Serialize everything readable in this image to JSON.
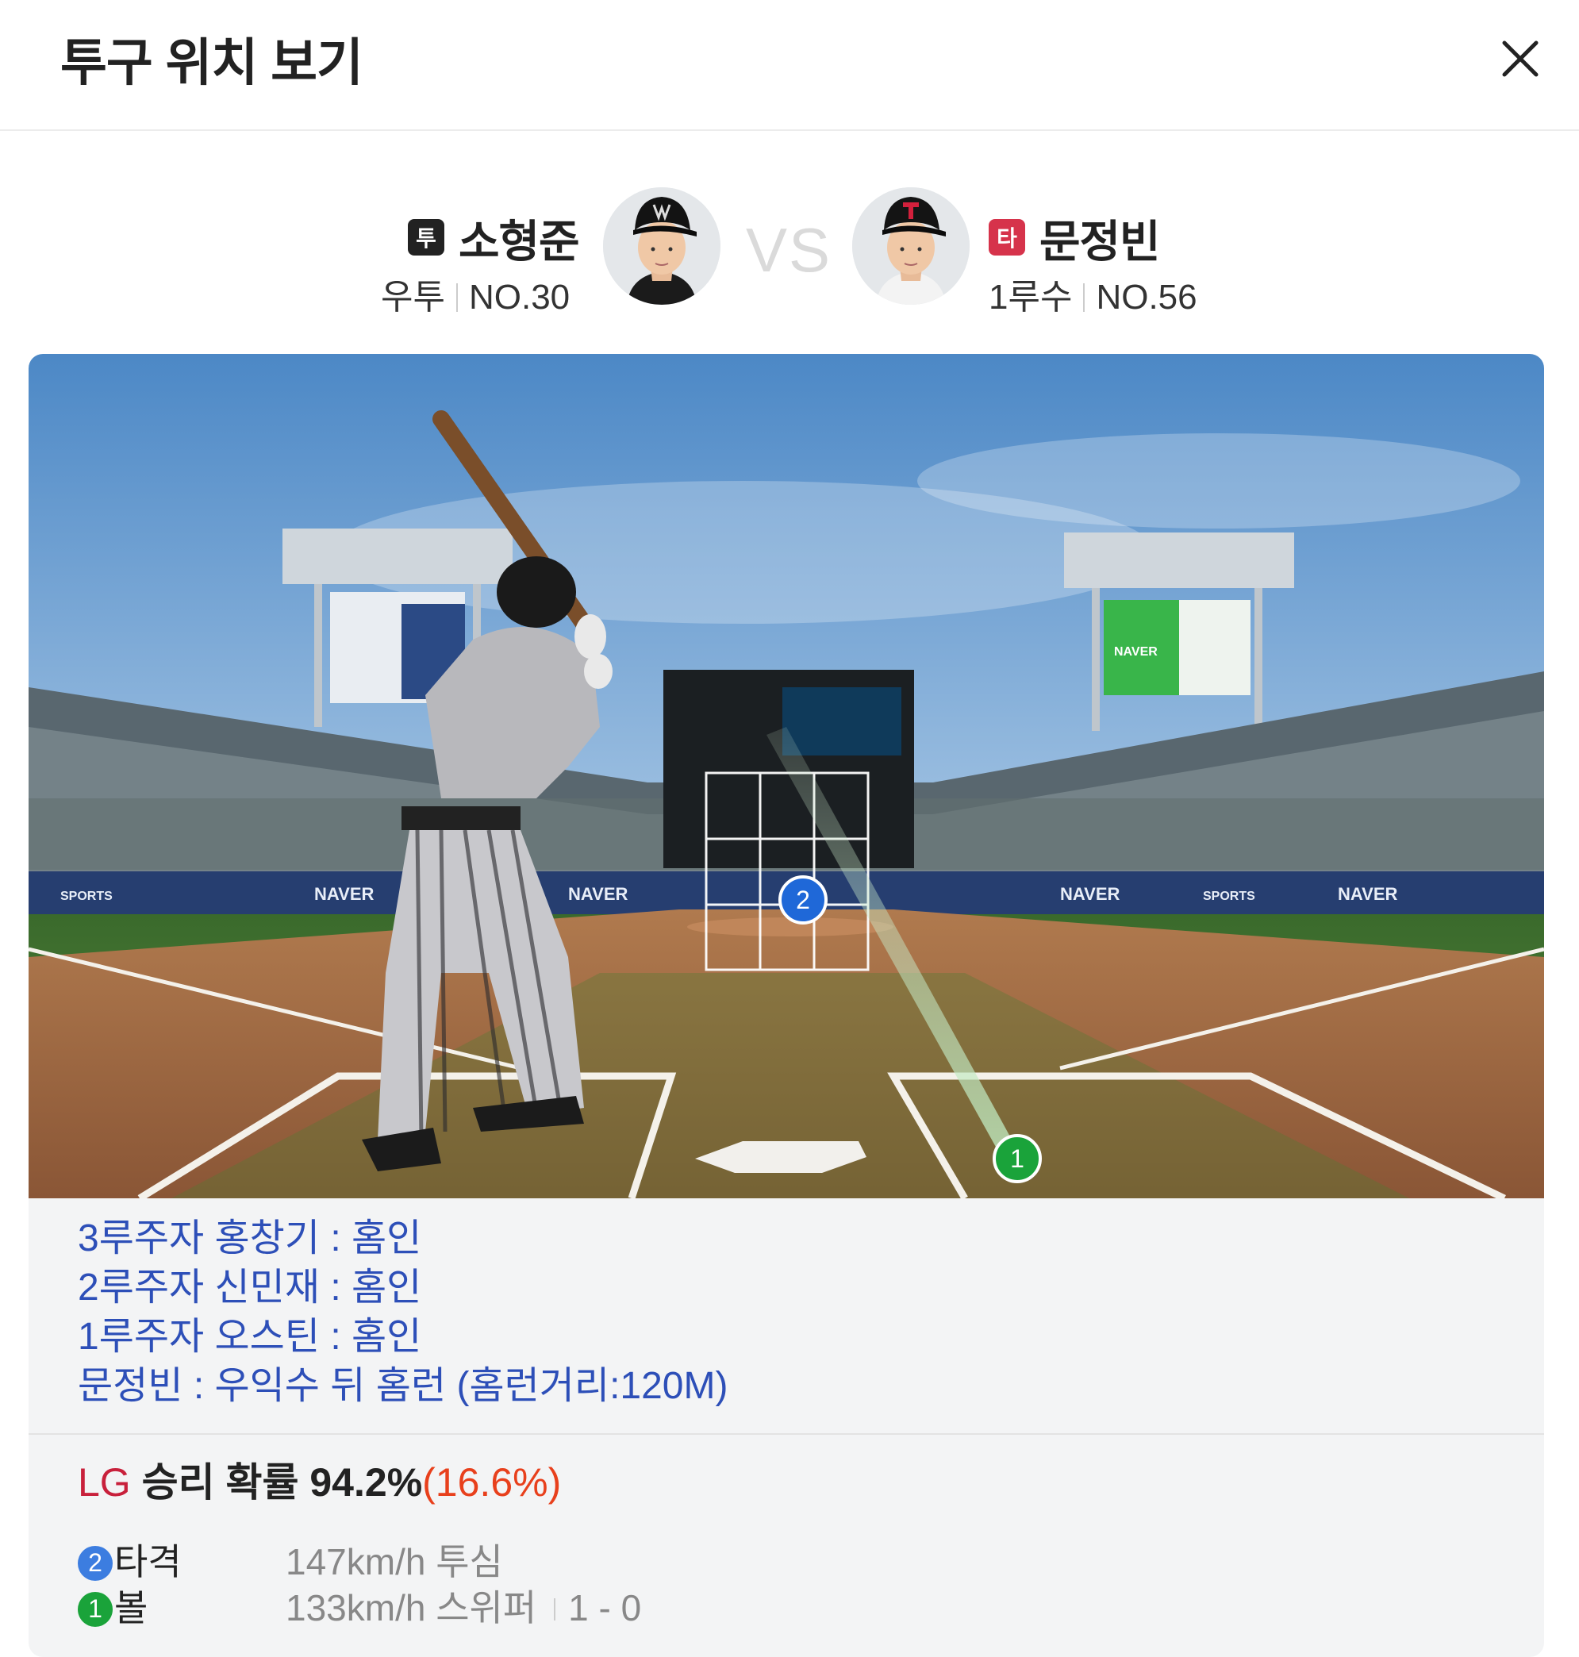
{
  "header": {
    "title": "투구 위치 보기",
    "close_icon": "close-icon"
  },
  "pitcher": {
    "role_badge": "투",
    "name": "소형준",
    "throws": "우투",
    "number": "NO.30",
    "badge_color": "#222222"
  },
  "batter": {
    "role_badge": "타",
    "name": "문정빈",
    "position": "1루수",
    "number": "NO.56",
    "badge_color": "#d6334b"
  },
  "vs_label": "VS",
  "pitch_markers": [
    {
      "label": "2",
      "color": "#1f68d8"
    },
    {
      "label": "1",
      "color": "#1aa33a"
    }
  ],
  "events": [
    "3루주자 홍창기 : 홈인",
    "2루주자 신민재 : 홈인",
    "1루주자 오스틴 : 홈인",
    "문정빈 : 우익수 뒤 홈런 (홈런거리:120M)"
  ],
  "win_probability": {
    "team": "LG",
    "label": " 승리 확률 94.2%",
    "delta": "(16.6%)"
  },
  "pitches": [
    {
      "num": "2",
      "type": "타격",
      "desc": "147km/h 투심",
      "count": "",
      "color": "#3c7de0"
    },
    {
      "num": "1",
      "type": "볼",
      "desc": "133km/h 스위퍼",
      "count": "1 - 0",
      "color": "#1aa33a"
    }
  ],
  "stadium": {
    "banner_brand": "NAVER",
    "banner_brand_2": "SPORTS"
  }
}
